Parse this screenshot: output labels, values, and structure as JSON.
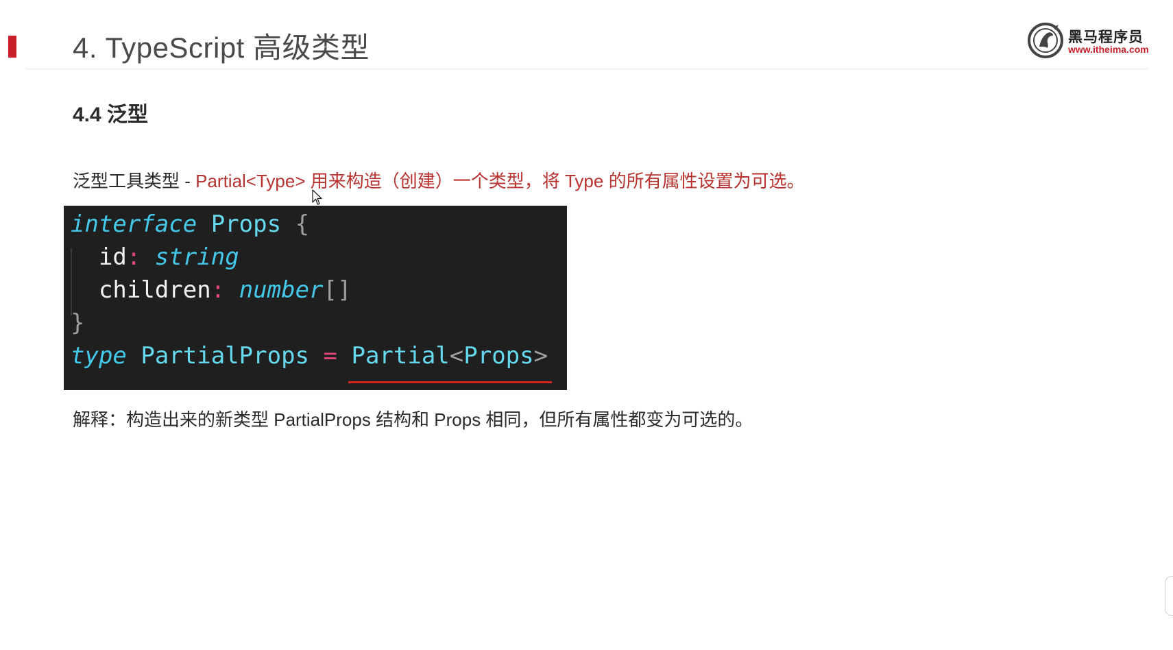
{
  "header": {
    "title": "4. TypeScript 高级类型",
    "logo_name": "黑马程序员",
    "logo_url": "www.itheima.com"
  },
  "section": {
    "heading": "4.4 泛型"
  },
  "description": {
    "prefix": "泛型工具类型 - ",
    "highlight": "Partial<Type> 用来构造（创建）一个类型，将 Type 的所有属性设置为可选。"
  },
  "code": {
    "line1": {
      "kw": "interface",
      "name": "Props",
      "brace": "{"
    },
    "line2": {
      "prop": "id",
      "colon": ":",
      "type": "string"
    },
    "line3": {
      "prop": "children",
      "colon": ":",
      "type": "number",
      "suffix": "[]"
    },
    "line4": {
      "brace": "}"
    },
    "line5": {
      "kw": "type",
      "name": "PartialProps",
      "op": "=",
      "generic": "Partial",
      "lt": "<",
      "arg": "Props",
      "gt": ">"
    }
  },
  "explanation": {
    "text": "解释：构造出来的新类型 PartialProps 结构和 Props 相同，但所有属性都变为可选的。"
  },
  "colors": {
    "accent": "#c8212b",
    "highlight_text": "#b8322f",
    "code_bg": "#1f1f1f",
    "keyword": "#44c7e8",
    "operator": "#e0457b"
  },
  "icons": {
    "logo": "itheima-horse-logo-icon",
    "cursor": "mouse-pointer-icon"
  }
}
